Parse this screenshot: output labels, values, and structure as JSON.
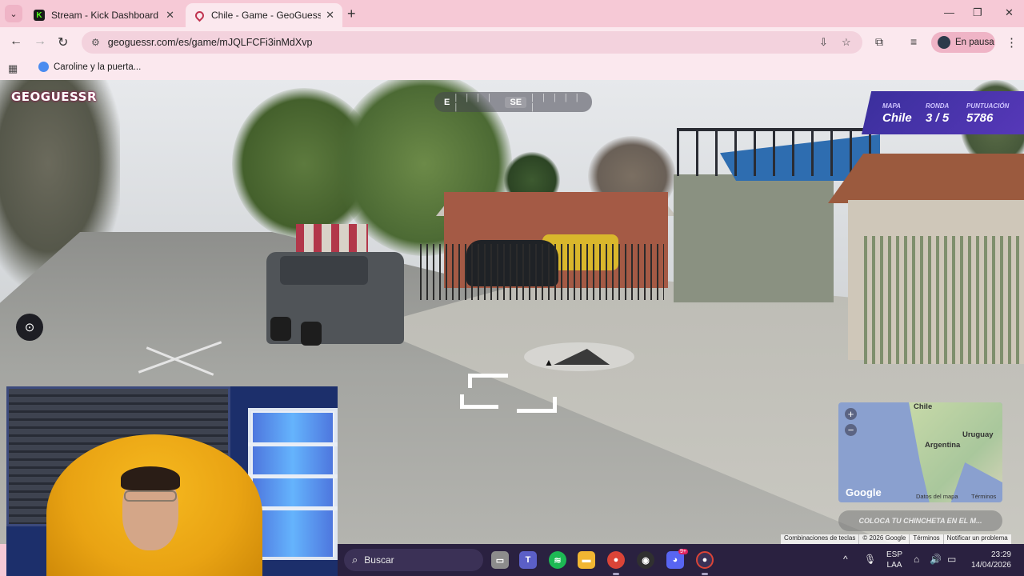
{
  "browser": {
    "tabs": [
      {
        "title": "Stream - Kick Dashboard",
        "favicon": "kick-logo-icon",
        "active": false
      },
      {
        "title": "Chile - Game - GeoGuessr",
        "favicon": "geoguessr-pin-icon",
        "active": true
      }
    ],
    "url": "geoguessr.com/es/game/mJQLFCFi3inMdXvp",
    "profile_label": "En pausa",
    "bookmarks": [
      {
        "label": "Caroline y la puerta..."
      }
    ],
    "colors": {
      "chrome": "#f6c9d6",
      "toolbar": "#fbe8ee"
    }
  },
  "game": {
    "logo": "GEOGUESSR",
    "compass": {
      "left": "E",
      "center": "SE"
    },
    "status": {
      "map_label": "MAPA",
      "map_value": "Chile",
      "round_label": "RONDA",
      "round_value": "3 / 5",
      "score_label": "PUNTUACIÓN",
      "score_value": "5786"
    },
    "minimap": {
      "labels": {
        "chile": "Chile",
        "argentina": "Argentina",
        "uruguay": "Uruguay"
      },
      "zoom_in": "+",
      "zoom_out": "−",
      "google": "Google",
      "map_data": "Datos del mapa",
      "terms": "Términos"
    },
    "guess_button": "COLOCA TU CHINCHETA EN EL M...",
    "attribution": [
      "Combinaciones de teclas",
      "© 2026 Google",
      "Términos",
      "Notificar un problema"
    ],
    "colors": {
      "status_bg": "#4a36b0",
      "accent_label": "#cfc4ff"
    }
  },
  "taskbar": {
    "search_placeholder": "Buscar",
    "apps": [
      "file-explorer-icon",
      "teams-icon",
      "spotify-icon",
      "folder-icon",
      "chrome-icon",
      "obs-icon",
      "discord-icon",
      "chrome-profile-icon"
    ],
    "discord_badge": "9+",
    "lang_top": "ESP",
    "lang_bottom": "LAA",
    "time": "23:29",
    "date": "14/04/2026"
  }
}
